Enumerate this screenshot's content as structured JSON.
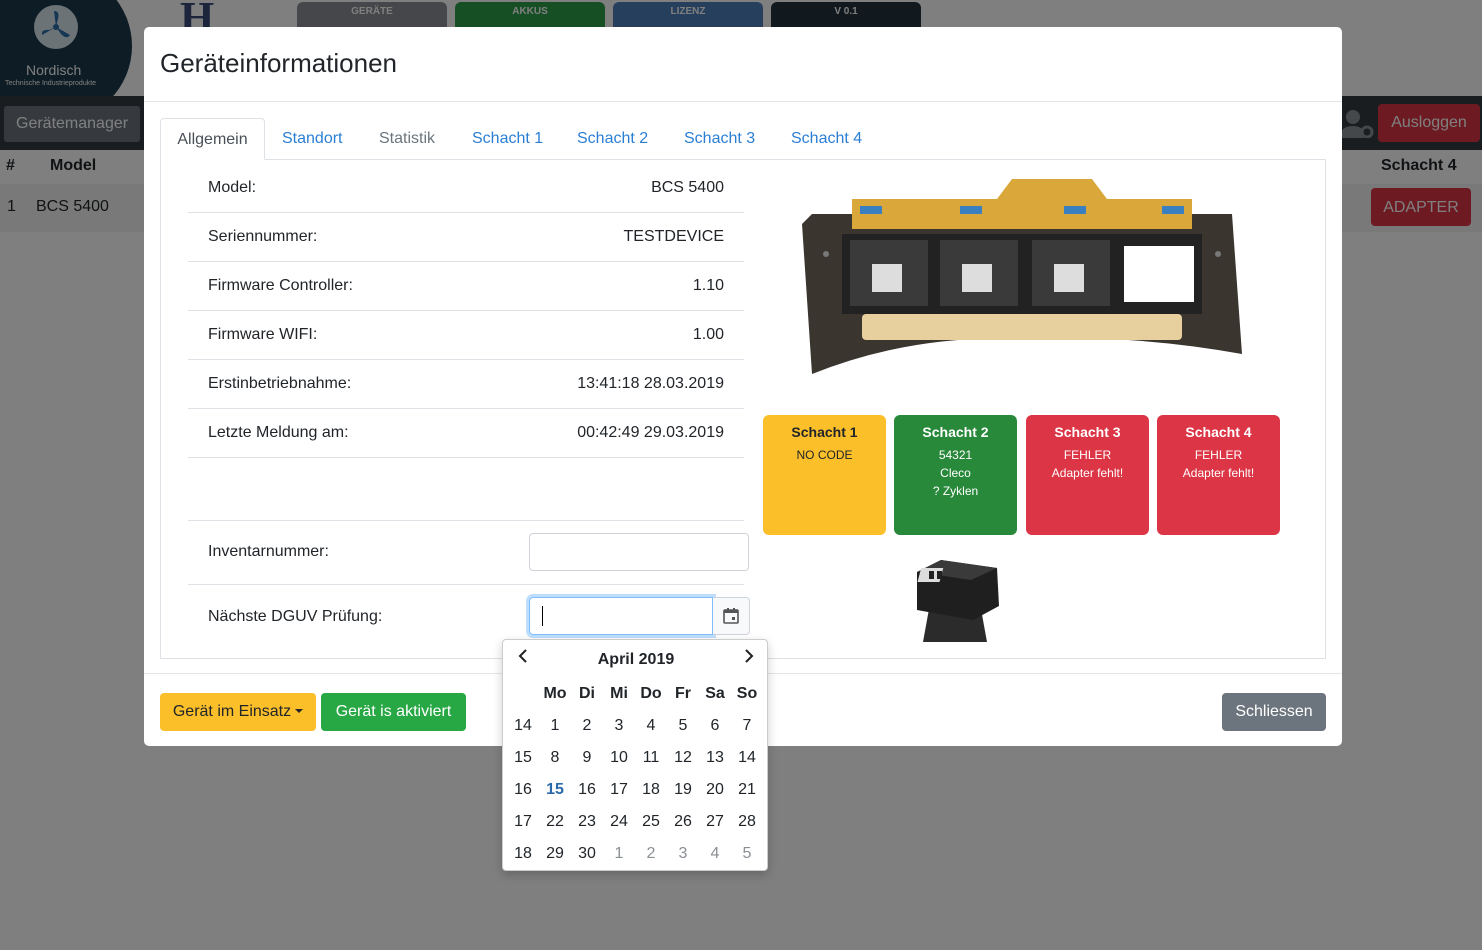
{
  "app": {
    "logo_name": "Nordisch",
    "logo_sub": "Technische Industrieprodukte",
    "top_tabs": [
      "GERÄTE",
      "AKKUS",
      "LIZENZ",
      "V 0.1"
    ],
    "nav_brand": "Gerätemanager",
    "logout": "Ausloggen",
    "table": {
      "headers": [
        "#",
        "Model",
        "Schacht 4"
      ],
      "row": {
        "num": "1",
        "model": "BCS 5400",
        "schacht4_button": "ADAPTER"
      }
    }
  },
  "modal": {
    "title": "Geräteinformationen",
    "tabs": [
      {
        "label": "Allgemein",
        "state": "active"
      },
      {
        "label": "Standort",
        "state": "link"
      },
      {
        "label": "Statistik",
        "state": "disabled"
      },
      {
        "label": "Schacht 1",
        "state": "link"
      },
      {
        "label": "Schacht 2",
        "state": "link"
      },
      {
        "label": "Schacht 3",
        "state": "link"
      },
      {
        "label": "Schacht 4",
        "state": "link"
      }
    ],
    "info": [
      {
        "label": "Model:",
        "value": "BCS 5400"
      },
      {
        "label": "Seriennummer:",
        "value": "TESTDEVICE"
      },
      {
        "label": "Firmware Controller:",
        "value": "1.10"
      },
      {
        "label": "Firmware WIFI:",
        "value": "1.00"
      },
      {
        "label": "Erstinbetriebnahme:",
        "value": "13:41:18 28.03.2019"
      },
      {
        "label": "Letzte Meldung am:",
        "value": "00:42:49 29.03.2019"
      }
    ],
    "inventory_label": "Inventarnummer:",
    "inventory_value": "",
    "dguv_label": "Nächste DGUV Prüfung:",
    "dguv_value": "",
    "slots": [
      {
        "title": "Schacht 1",
        "lines": [
          "NO CODE"
        ],
        "status_color": "#fbbf2a"
      },
      {
        "title": "Schacht 2",
        "lines": [
          "54321",
          "Cleco",
          "? Zyklen"
        ],
        "status_color": "#28893a"
      },
      {
        "title": "Schacht 3",
        "lines": [
          "FEHLER",
          "Adapter fehlt!"
        ],
        "status_color": "#dc3545"
      },
      {
        "title": "Schacht 4",
        "lines": [
          "FEHLER",
          "Adapter fehlt!"
        ],
        "status_color": "#dc3545"
      }
    ],
    "footer": {
      "status_dropdown": "Gerät im Einsatz",
      "activated_button": "Gerät is aktiviert",
      "close_button": "Schliessen"
    }
  },
  "datepicker": {
    "month_label": "April 2019",
    "weekday_headers": [
      "",
      "Mo",
      "Di",
      "Mi",
      "Do",
      "Fr",
      "Sa",
      "So"
    ],
    "weeks": [
      {
        "week": "14",
        "days": [
          "1",
          "2",
          "3",
          "4",
          "5",
          "6",
          "7"
        ]
      },
      {
        "week": "15",
        "days": [
          "8",
          "9",
          "10",
          "11",
          "12",
          "13",
          "14"
        ]
      },
      {
        "week": "16",
        "days": [
          "15",
          "16",
          "17",
          "18",
          "19",
          "20",
          "21"
        ]
      },
      {
        "week": "17",
        "days": [
          "22",
          "23",
          "24",
          "25",
          "26",
          "27",
          "28"
        ]
      },
      {
        "week": "18",
        "days": [
          "29",
          "30",
          "1",
          "2",
          "3",
          "4",
          "5"
        ]
      }
    ],
    "highlighted_day": "15",
    "icons": {
      "prev": "chevron-left-icon",
      "next": "chevron-right-icon",
      "calendar": "calendar-icon"
    }
  }
}
